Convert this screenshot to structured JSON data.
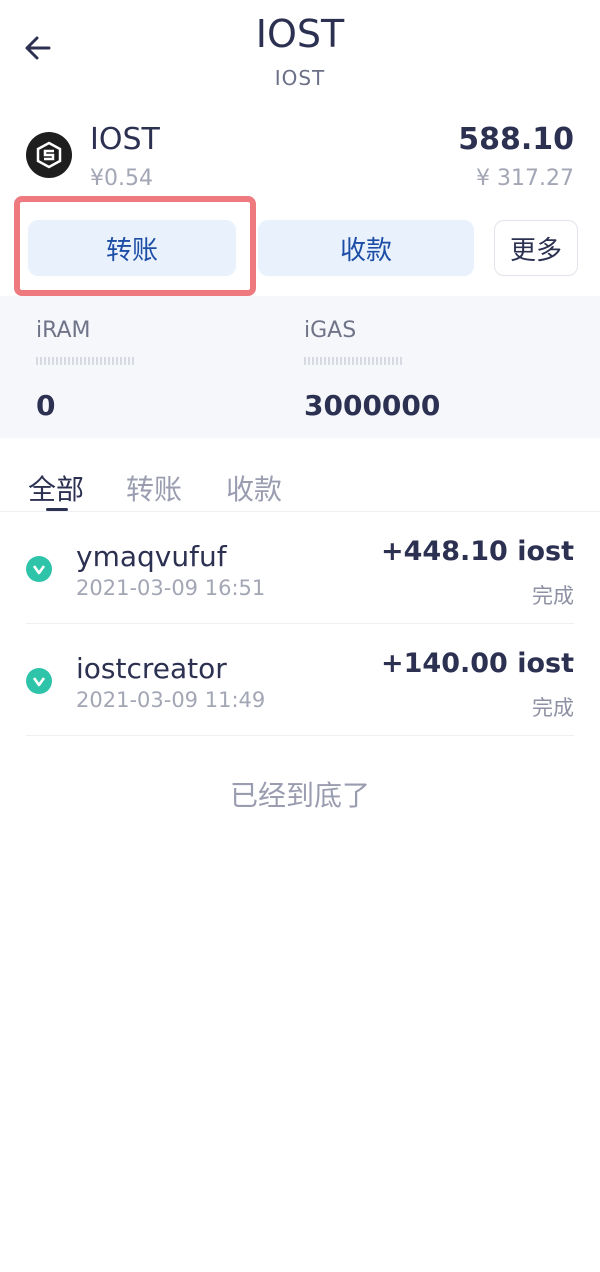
{
  "header": {
    "title": "IOST",
    "subtitle": "IOST"
  },
  "token": {
    "name": "IOST",
    "price": "¥0.54",
    "amount": "588.10",
    "value": "¥ 317.27"
  },
  "actions": {
    "transfer_label": "转账",
    "receive_label": "收款",
    "more_label": "更多"
  },
  "resources": {
    "ram": {
      "label": "iRAM",
      "value": "0"
    },
    "gas": {
      "label": "iGAS",
      "value": "3000000"
    }
  },
  "tabs": [
    {
      "label": "全部",
      "active": true
    },
    {
      "label": "转账",
      "active": false
    },
    {
      "label": "收款",
      "active": false
    }
  ],
  "transactions": [
    {
      "name": "ymaqvufuf",
      "time": "2021-03-09 16:51",
      "amount": "+448.10 iost",
      "status": "完成"
    },
    {
      "name": "iostcreator",
      "time": "2021-03-09 11:49",
      "amount": "+140.00 iost",
      "status": "完成"
    }
  ],
  "list_end_text": "已经到底了",
  "colors": {
    "primary_text": "#2c3152",
    "button_bg": "#e9f1fd",
    "button_text": "#1d4ea6",
    "highlight": "#ee7a7f",
    "tx_icon": "#2ec4a9"
  },
  "icons": {
    "back": "arrow-left-icon",
    "token_logo": "iost-logo-icon",
    "tx": "chevron-down-circle-icon"
  }
}
